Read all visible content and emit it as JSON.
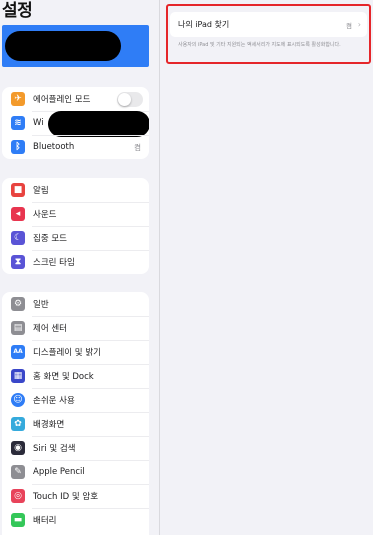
{
  "sidebar": {
    "title": "설정",
    "group1": [
      {
        "label": "에어플레인 모드",
        "icon": "airplane-icon",
        "color": "#f39a2b",
        "glyph": "✈",
        "toggle": false
      },
      {
        "label": "Wi",
        "icon": "wifi-icon",
        "color": "#2f7df6",
        "glyph": "≋"
      },
      {
        "label": "Bluetooth",
        "icon": "bluetooth-icon",
        "color": "#2f7df6",
        "glyph": "ᛒ",
        "value": "켬"
      }
    ],
    "group2": [
      {
        "label": "알림",
        "icon": "notifications-icon",
        "color": "#e8433f",
        "glyph": "■"
      },
      {
        "label": "사운드",
        "icon": "sound-icon",
        "color": "#e8354f",
        "glyph": "◂"
      },
      {
        "label": "집중 모드",
        "icon": "focus-moon-icon",
        "color": "#5a54d6",
        "glyph": "☾"
      },
      {
        "label": "스크린 타임",
        "icon": "hourglass-icon",
        "color": "#5a54d6",
        "glyph": "⧗"
      }
    ],
    "group3": [
      {
        "label": "일반",
        "icon": "gear-icon",
        "color": "#8e8e93",
        "glyph": "⚙"
      },
      {
        "label": "제어 센터",
        "icon": "control-center-icon",
        "color": "#8e8e93",
        "glyph": "▤"
      },
      {
        "label": "디스플레이 및 밝기",
        "icon": "display-brightness-icon",
        "color": "#2f7df6",
        "glyph": "AA"
      },
      {
        "label": "홈 화면 및 Dock",
        "icon": "home-screen-icon",
        "color": "#3a47c9",
        "glyph": "▦"
      },
      {
        "label": "손쉬운 사용",
        "icon": "accessibility-icon",
        "color": "#2f7df6",
        "glyph": "☺"
      },
      {
        "label": "배경화면",
        "icon": "wallpaper-icon",
        "color": "#35aadc",
        "glyph": "✿"
      },
      {
        "label": "Siri 및 검색",
        "icon": "siri-icon",
        "color": "#2b2b3a",
        "glyph": "◉"
      },
      {
        "label": "Apple Pencil",
        "icon": "apple-pencil-icon",
        "color": "#8e8e93",
        "glyph": "✎"
      },
      {
        "label": "Touch ID 및 암호",
        "icon": "touch-id-icon",
        "color": "#e8435a",
        "glyph": "◎"
      },
      {
        "label": "배터리",
        "icon": "battery-icon",
        "color": "#34c759",
        "glyph": "▬"
      }
    ]
  },
  "detail": {
    "find_my_title": "나의 iPad 찾기",
    "find_my_value": "켬",
    "chevron": "›",
    "footnote": "사용자의 iPad 및 기타 지원되는 액세서리가 지도에 표시되도록 활성화합니다."
  },
  "colors": {
    "accent": "#2f7df6",
    "highlight": "#e5262a"
  }
}
